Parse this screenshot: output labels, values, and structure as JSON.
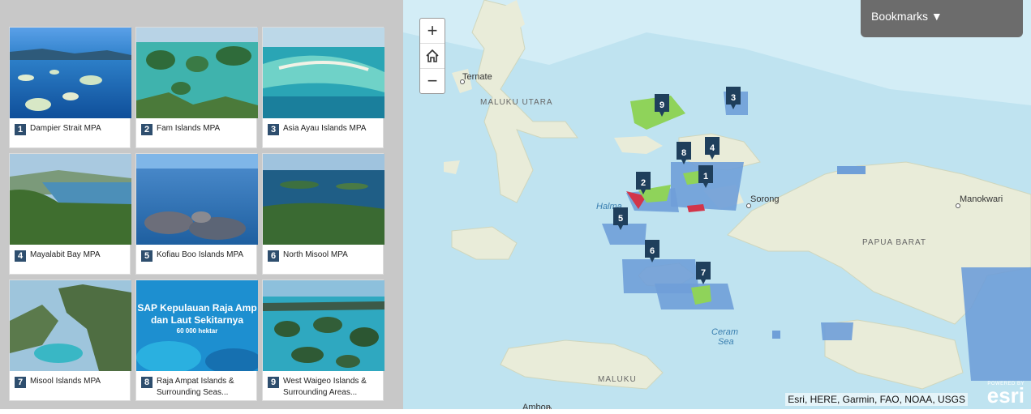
{
  "cards": [
    {
      "num": "1",
      "title": "Dampier Strait MPA"
    },
    {
      "num": "2",
      "title": "Fam Islands MPA"
    },
    {
      "num": "3",
      "title": "Asia Ayau Islands MPA"
    },
    {
      "num": "4",
      "title": "Mayalabit Bay MPA"
    },
    {
      "num": "5",
      "title": "Kofiau Boo Islands MPA"
    },
    {
      "num": "6",
      "title": "North Misool MPA"
    },
    {
      "num": "7",
      "title": "Misool Islands MPA"
    },
    {
      "num": "8",
      "title": "Raja Ampat Islands & Surrounding Seas..."
    },
    {
      "num": "9",
      "title": "West Waigeo Islands & Surrounding Areas..."
    }
  ],
  "card8_overlay": {
    "line1": "SAP Kepulauan Raja Amp",
    "line2": "dan Laut Sekitarnya",
    "line3": "60 000 hektar"
  },
  "map": {
    "bookmarks_label": "Bookmarks ▼",
    "zoom_in": "+",
    "zoom_out": "−",
    "home_icon": "home-icon",
    "places": {
      "ternate": "Ternate",
      "maluku_utara": "MALUKU UTARA",
      "halma": "Halma",
      "sorong": "Sorong",
      "manokwari": "Manokwari",
      "papua_barat": "PAPUA BARAT",
      "ceram1": "Ceram",
      "ceram2": "Sea",
      "maluku": "MALUKU",
      "ambon": "Ambon"
    },
    "markers": [
      "1",
      "2",
      "3",
      "4",
      "5",
      "6",
      "7",
      "8",
      "9"
    ],
    "attribution": "Esri, HERE, Garmin, FAO, NOAA, USGS",
    "powered_by": "POWERED BY",
    "esri_logo": "esri"
  },
  "colors": {
    "marker": "#1f3f5c",
    "mpa_blue": "#6f9fd8",
    "mpa_green": "#8fd35a",
    "mpa_red": "#d2354a",
    "land": "#e9ecd9",
    "sea": "#bfe3f0"
  }
}
